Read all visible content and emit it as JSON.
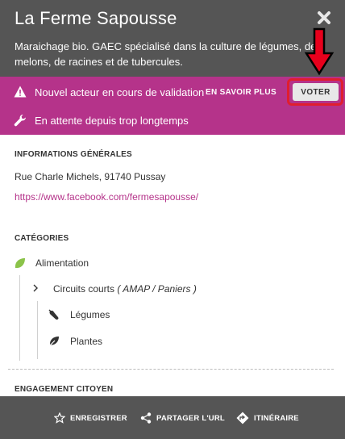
{
  "header": {
    "title": "La Ferme Sapousse",
    "description": "Maraichage bio. GAEC spécialisé dans la culture de légumes, de melons, de racines et de tubercules."
  },
  "alert": {
    "message": "Nouvel acteur en cours de validation",
    "more_label": "EN SAVOIR PLUS",
    "vote_label": "VOTER",
    "pending_message": "En attente depuis trop longtemps",
    "background": "#b5338a",
    "annotation_color": "#e01e2e"
  },
  "general_info": {
    "title": "INFORMATIONS GÉNÉRALES",
    "address": "Rue Charle Michels, 91740 Pussay",
    "website": "https://www.facebook.com/fermesapousse/"
  },
  "categories": {
    "title": "CATÉGORIES",
    "main": {
      "label": "Alimentation",
      "icon": "leaf-icon",
      "color": "#8bc34a"
    },
    "sub": {
      "label": "Circuits courts",
      "detail": "( AMAP / Paniers )"
    },
    "items": [
      {
        "label": "Légumes",
        "icon": "eggplant-icon"
      },
      {
        "label": "Plantes",
        "icon": "plant-icon"
      }
    ]
  },
  "engagement": {
    "title": "ENGAGEMENT CITOYEN"
  },
  "footer": {
    "save_label": "ENREGISTRER",
    "share_label": "PARTAGER L'URL",
    "route_label": "ITINÉRAIRE"
  }
}
